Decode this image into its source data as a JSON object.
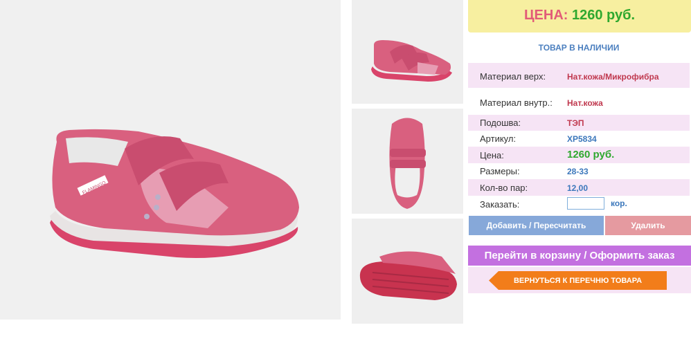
{
  "price_banner": {
    "label": "ЦЕНА:",
    "value": "1260 руб."
  },
  "stock_status": "ТОВАР В НАЛИЧИИ",
  "specs": {
    "material_top": {
      "label": "Материал верх:",
      "value": "Нат.кожа/Микрофибра"
    },
    "material_inner": {
      "label": "Материал внутр.:",
      "value": "Нат.кожа"
    },
    "sole": {
      "label": "Подошва:",
      "value": "ТЭП"
    },
    "article": {
      "label": "Артикул:",
      "value": "XP5834"
    },
    "price": {
      "label": "Цена:",
      "value": "1260 руб."
    },
    "sizes": {
      "label": "Размеры:",
      "value": "28-33"
    },
    "pairs": {
      "label": "Кол-во пар:",
      "value": "12,00"
    },
    "order": {
      "label": "Заказать:",
      "input_value": "",
      "unit": "кор."
    }
  },
  "buttons": {
    "add": "Добавить / Пересчитать",
    "delete": "Удалить",
    "cart": "Перейти в корзину / Оформить заказ",
    "back": "ВЕРНУТЬСЯ К ПЕРЕЧНЮ ТОВАРА"
  },
  "product_images": {
    "main": "pink-sneaker-side-view",
    "thumbs": [
      "pink-sneaker-side-view",
      "pink-sneaker-top-view",
      "pink-sneaker-sole-view"
    ]
  },
  "brand_text": "FLAMINGO",
  "colors": {
    "shoe": "#d9607f",
    "price_label": "#e25b78",
    "price_value": "#2fa82f",
    "back_button": "#f27d1a",
    "cart_button": "#c370e0"
  }
}
